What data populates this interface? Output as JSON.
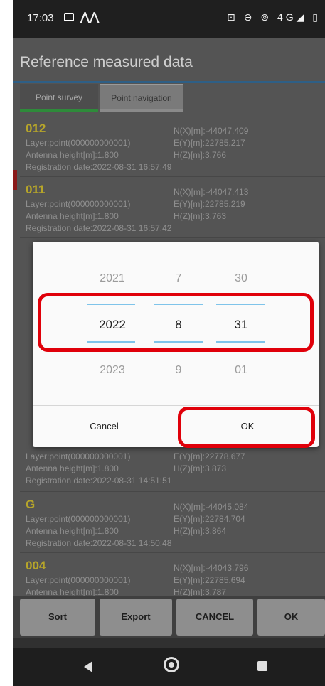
{
  "status_bar": {
    "time": "17:03",
    "right_icons": "⊡ ⊖ ⊚ 4G◢ ▯"
  },
  "screen": {
    "title": "Reference measured data"
  },
  "tabs": [
    "Point survey",
    "Point navigation"
  ],
  "records_top": [
    {
      "name": "012",
      "layer": "Layer:point(000000000001)",
      "antenna": "Antenna height[m]:1.800",
      "date": "Registration date:2022-08-31 16:57:49",
      "n": "N(X)[m]:-44047.409",
      "e": "E(Y)[m]:22785.217",
      "h": "H(Z)[m]:3.766"
    },
    {
      "name": "011",
      "layer": "Layer:point(000000000001)",
      "antenna": "Antenna height[m]:1.800",
      "date": "Registration date:2022-08-31 16:57:42",
      "n": "N(X)[m]:-44047.413",
      "e": "E(Y)[m]:22785.219",
      "h": "H(Z)[m]:3.763"
    }
  ],
  "records_bottom": [
    {
      "name": "",
      "layer": "Layer:point(000000000001)",
      "antenna": "Antenna height[m]:1.800",
      "date": "Registration date:2022-08-31 14:51:51",
      "n": "",
      "e": "E(Y)[m]:22778.677",
      "h": "H(Z)[m]:3.873"
    },
    {
      "name": "G",
      "layer": "Layer:point(000000000001)",
      "antenna": "Antenna height[m]:1.800",
      "date": "Registration date:2022-08-31 14:50:48",
      "n": "N(X)[m]:-44045.084",
      "e": "E(Y)[m]:22784.704",
      "h": "H(Z)[m]:3.864"
    },
    {
      "name": "004",
      "layer": "Layer:point(000000000001)",
      "antenna": "Antenna height[m]:1.800",
      "date": "",
      "n": "N(X)[m]:-44043.796",
      "e": "E(Y)[m]:22785.694",
      "h": "H(Z)[m]:3.787"
    }
  ],
  "toolbar": {
    "sort": "Sort",
    "export": "Export",
    "cancel": "CANCEL",
    "ok": "OK"
  },
  "date_picker": {
    "year": {
      "prev": "2021",
      "selected": "2022",
      "next": "2023"
    },
    "month": {
      "prev": "7",
      "selected": "8",
      "next": "9"
    },
    "day": {
      "prev": "30",
      "selected": "31",
      "next": "01"
    },
    "cancel_label": "Cancel",
    "ok_label": "OK"
  },
  "colors": {
    "highlight": "#e0000a",
    "accent": "#7fc4ea",
    "point_name": "#b6a52a"
  }
}
